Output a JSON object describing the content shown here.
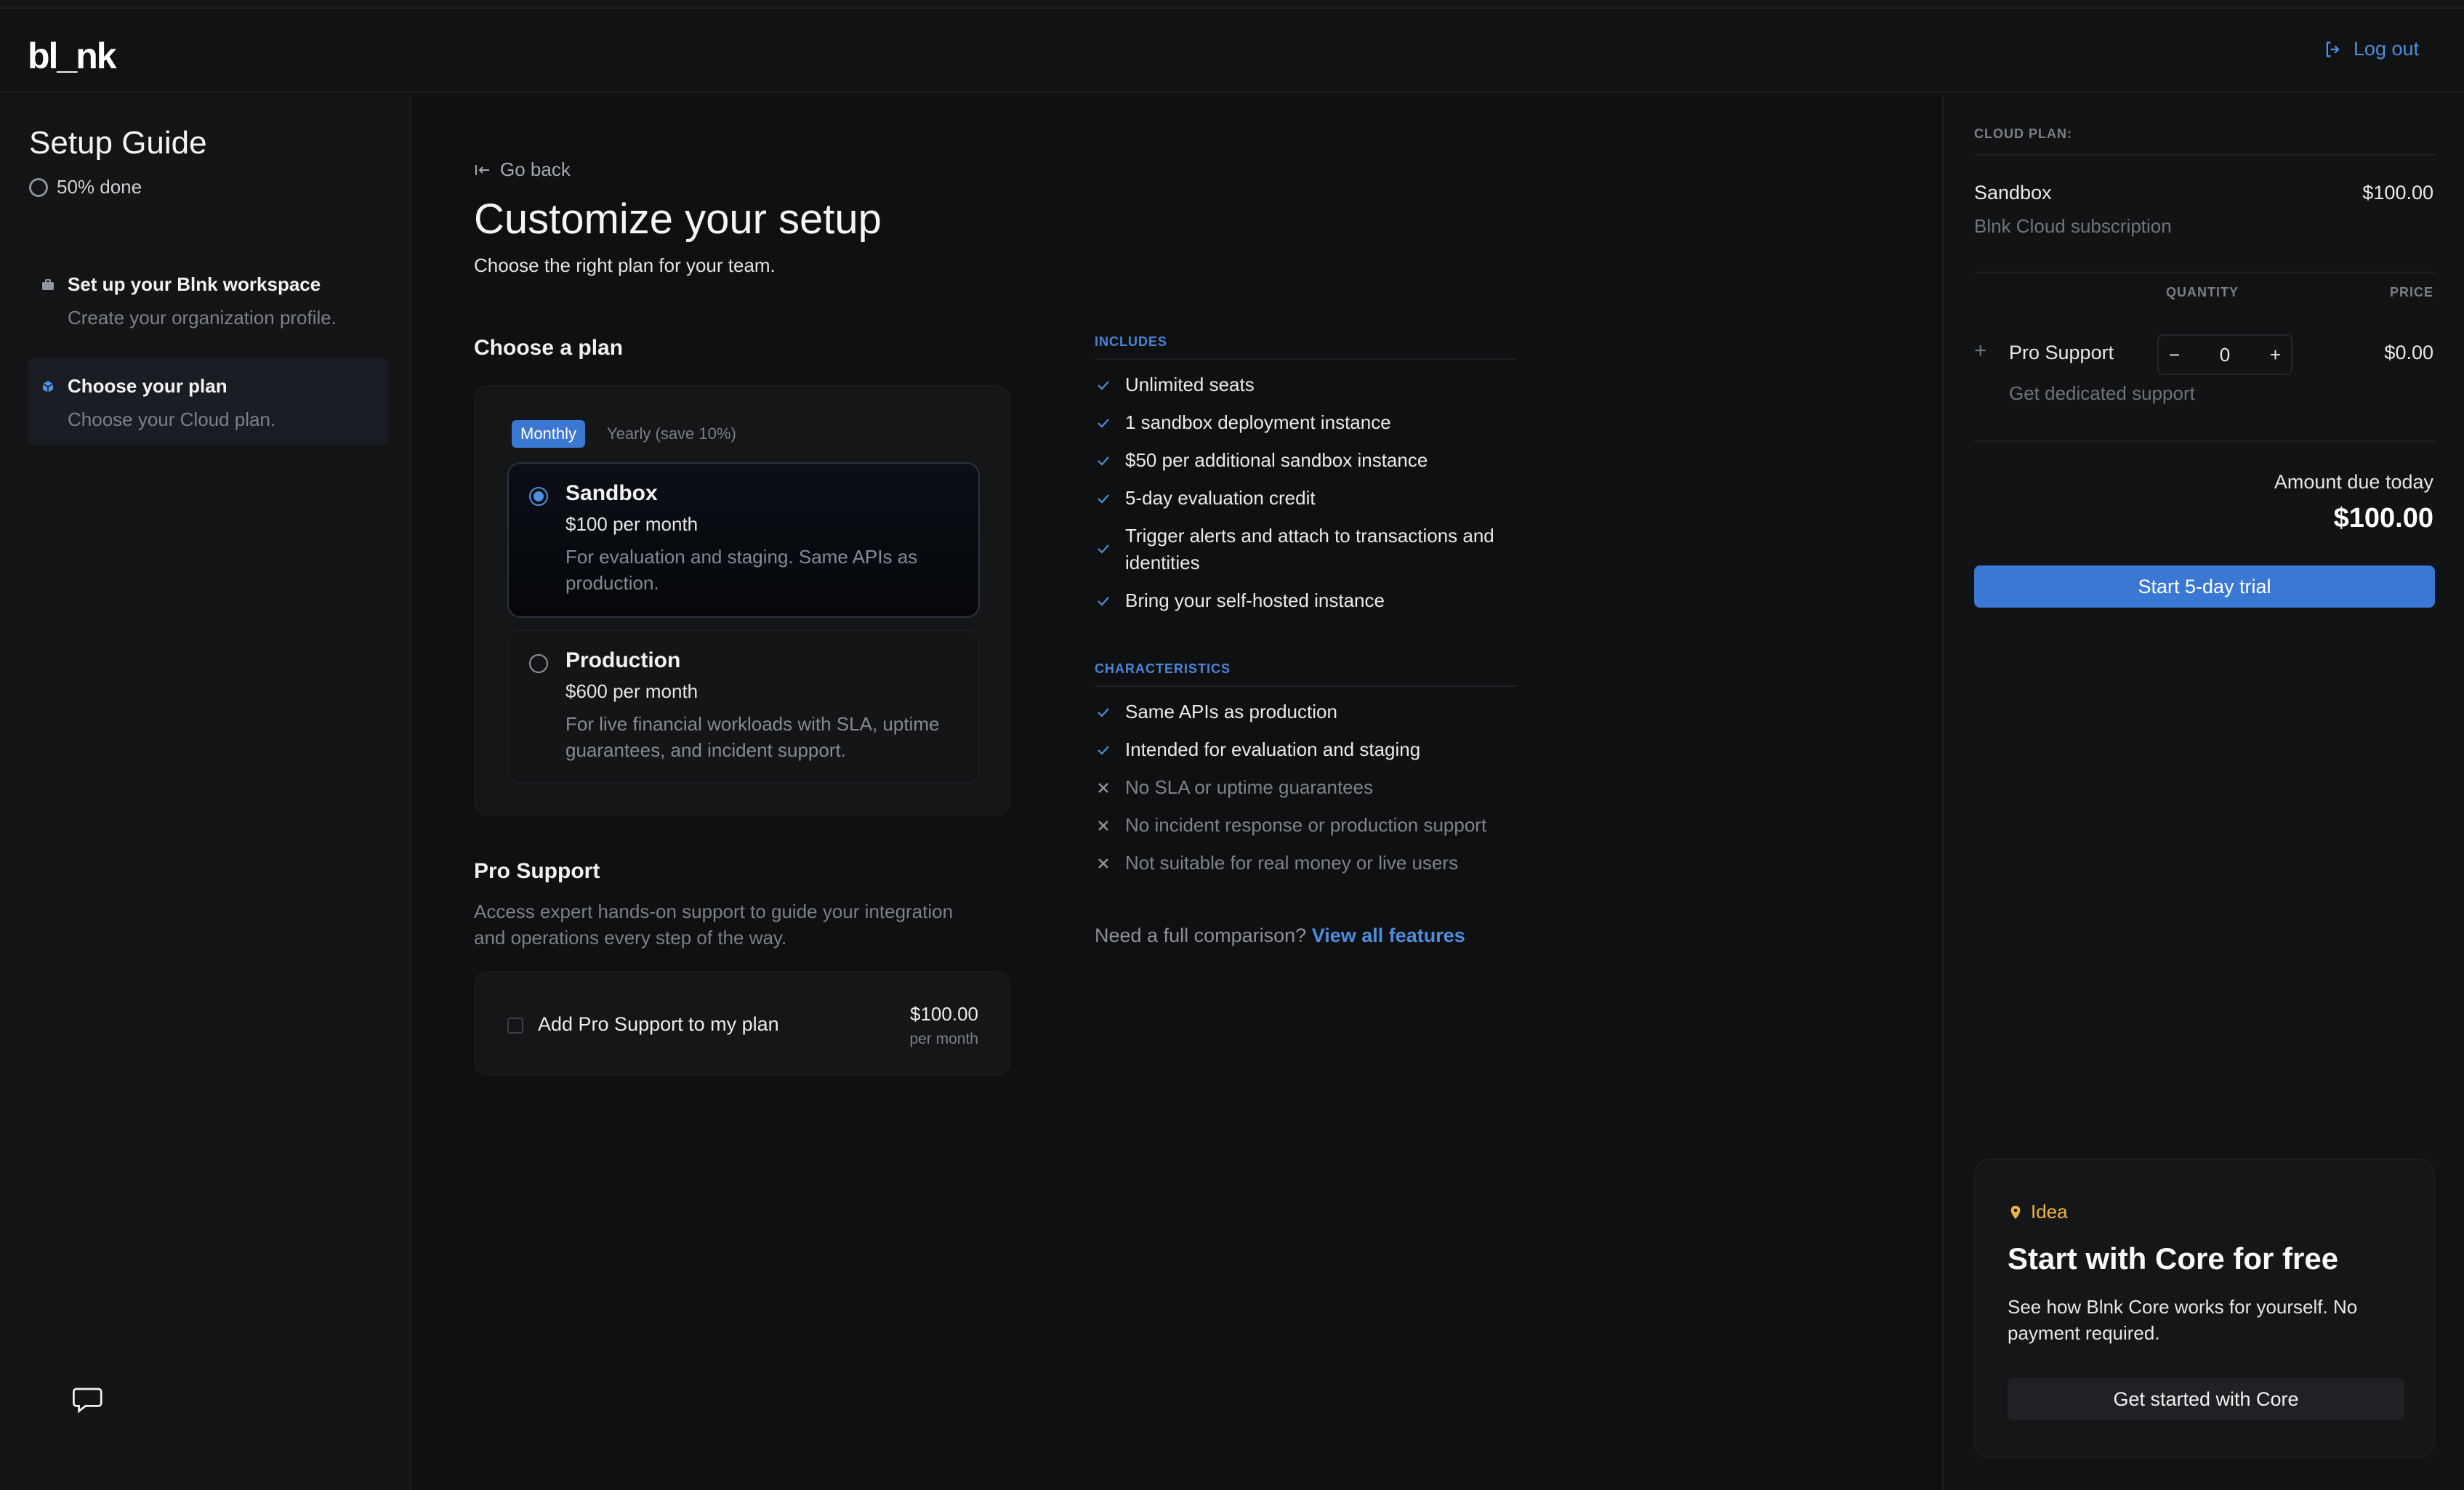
{
  "header": {
    "logo": "bl_nk",
    "logout_label": "Log out"
  },
  "sidebar": {
    "title": "Setup Guide",
    "progress": "50% done",
    "steps": [
      {
        "title": "Set up your Blnk workspace",
        "subtitle": "Create your organization profile."
      },
      {
        "title": "Choose your plan",
        "subtitle": "Choose your Cloud plan."
      }
    ]
  },
  "main": {
    "go_back": "Go back",
    "title": "Customize your setup",
    "subtitle": "Choose the right plan for your team.",
    "choose_plan_title": "Choose a plan",
    "billing_toggle": {
      "monthly": "Monthly",
      "yearly": "Yearly (save 10%)"
    },
    "plans": [
      {
        "name": "Sandbox",
        "price": "$100 per month",
        "desc": "For evaluation and staging. Same APIs as production.",
        "selected": true
      },
      {
        "name": "Production",
        "price": "$600 per month",
        "desc": "For live financial workloads with SLA, uptime guarantees, and incident support.",
        "selected": false
      }
    ],
    "pro_support": {
      "title": "Pro Support",
      "desc": "Access expert hands-on support to guide your integration and operations every step of the way.",
      "checkbox_label": "Add Pro Support to my plan",
      "amount": "$100.00",
      "per": "per month"
    },
    "includes_title": "INCLUDES",
    "includes": [
      "Unlimited seats",
      "1 sandbox deployment instance",
      "$50 per additional sandbox instance",
      "5-day evaluation credit",
      "Trigger alerts and attach to transactions and identities",
      "Bring your self-hosted instance"
    ],
    "characteristics_title": "CHARACTERISTICS",
    "characteristics_pos": [
      "Same APIs as production",
      "Intended for evaluation and staging"
    ],
    "characteristics_neg": [
      "No SLA or uptime guarantees",
      "No incident response or production support",
      "Not suitable for real money or live users"
    ],
    "compare_text": "Need a full comparison?",
    "compare_link": "View all features"
  },
  "summary": {
    "label": "CLOUD PLAN:",
    "plan_name": "Sandbox",
    "plan_price": "$100.00",
    "plan_sub": "Blnk Cloud subscription",
    "quantity_header": "QUANTITY",
    "price_header": "PRICE",
    "addon_name": "Pro Support",
    "addon_sub": "Get dedicated support",
    "addon_qty": "0",
    "addon_price": "$0.00",
    "due_label": "Amount due today",
    "due_amount": "$100.00",
    "cta": "Start 5-day trial"
  },
  "idea": {
    "tag": "Idea",
    "title": "Start with Core for free",
    "desc": "See how Blnk Core works for yourself. No payment required.",
    "button": "Get started with Core"
  },
  "colors": {
    "accent": "#3b78d4",
    "link": "#4e8ede",
    "idea": "#f0b640",
    "background": "#0f1011"
  }
}
